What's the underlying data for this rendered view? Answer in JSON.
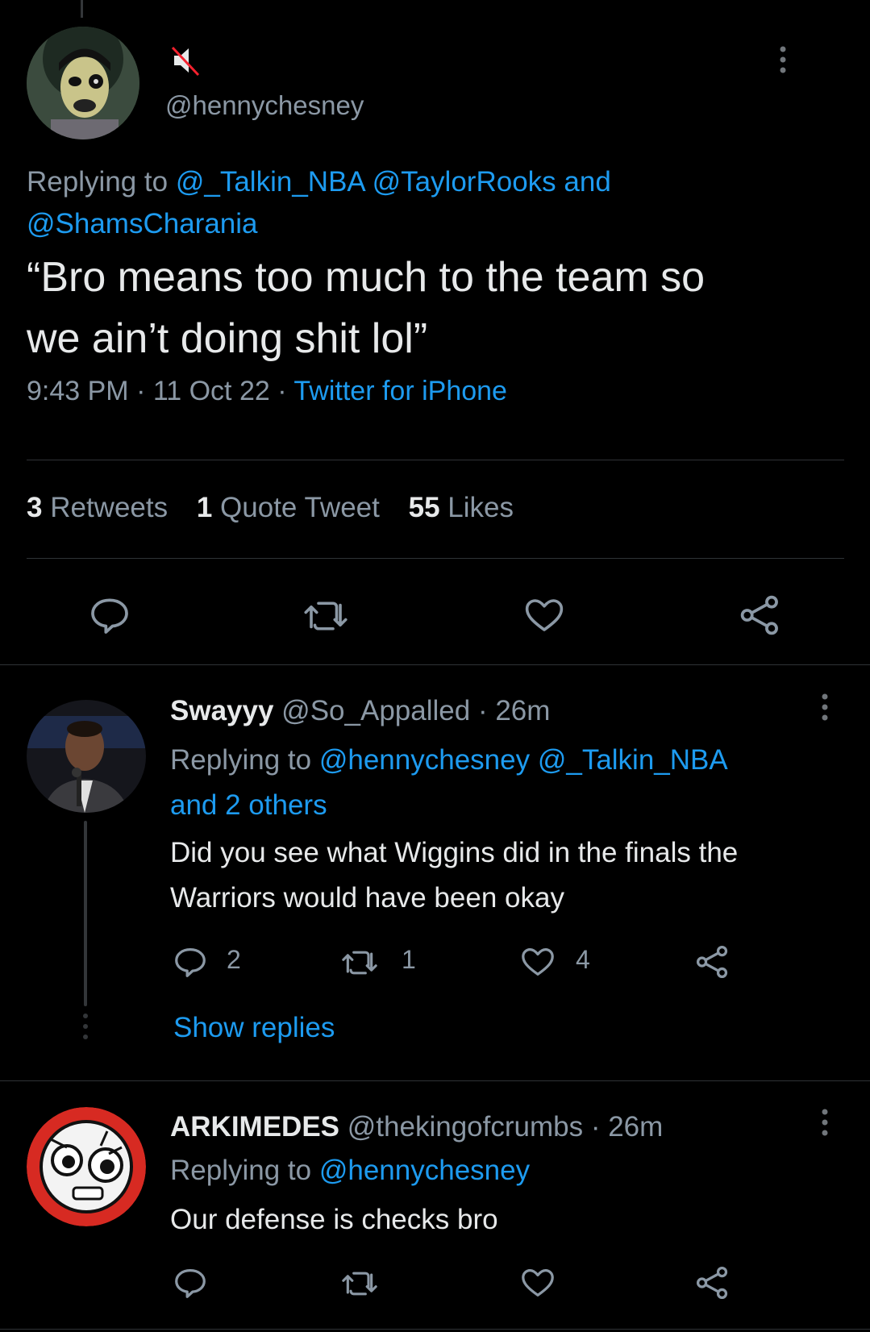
{
  "main_tweet": {
    "handle": "@hennychesney",
    "replying_prefix": "Replying to",
    "replying_handles": [
      "@_Talkin_NBA",
      "@TaylorRooks"
    ],
    "replying_and": "and",
    "replying_last": "@ShamsCharania",
    "text_line1": "“Bro means too much to the team so",
    "text_line2": "we ain’t doing shit lol”",
    "time": "9:43 PM",
    "sep": "·",
    "date": "11 Oct 22",
    "source": "Twitter for iPhone",
    "stats": {
      "retweets_count": "3",
      "retweets_label": "Retweets",
      "quotes_count": "1",
      "quotes_label": "Quote Tweet",
      "likes_count": "55",
      "likes_label": "Likes"
    }
  },
  "reply1": {
    "name": "Swayyy",
    "handle": "@So_Appalled",
    "sep": "·",
    "age": "26m",
    "replying_prefix": "Replying to",
    "replying_handles": "@hennychesney @_Talkin_NBA",
    "replying_more": "and 2 others",
    "text_line1": "Did you see what Wiggins did in the finals the",
    "text_line2": "Warriors would have been okay",
    "reply_count": "2",
    "retweet_count": "1",
    "like_count": "4",
    "show_replies": "Show replies"
  },
  "reply2": {
    "name": "ARKIMEDES",
    "handle": "@thekingofcrumbs",
    "sep": "·",
    "age": "26m",
    "replying_prefix": "Replying to",
    "replying_handles": "@hennychesney",
    "text": "Our defense is checks bro"
  },
  "colors": {
    "accent": "#1d9bf0",
    "muted": "#71767b",
    "text": "#e7e9ea",
    "background": "#000000"
  }
}
